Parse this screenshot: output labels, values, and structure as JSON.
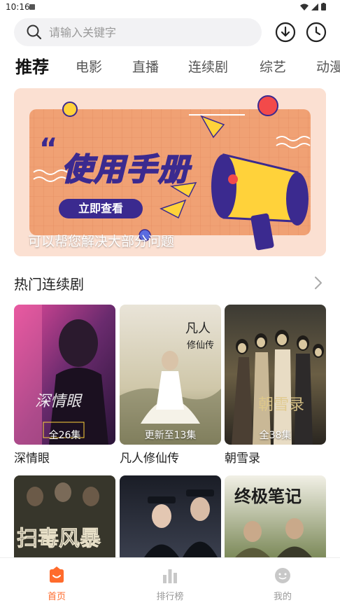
{
  "status_bar": {
    "time": "10:16"
  },
  "search": {
    "placeholder": "请输入关键字"
  },
  "tabs": [
    {
      "label": "推荐",
      "active": true
    },
    {
      "label": "电影",
      "active": false
    },
    {
      "label": "直播",
      "active": false
    },
    {
      "label": "连续剧",
      "active": false
    },
    {
      "label": "综艺",
      "active": false
    },
    {
      "label": "动漫",
      "active": false
    }
  ],
  "banner": {
    "title": "使用手册",
    "button_label": "立即查看",
    "caption": "可以帮您解决大部分问题"
  },
  "section": {
    "title": "热门连续剧"
  },
  "shows": [
    {
      "name": "深情眼",
      "badge": "全26集"
    },
    {
      "name": "凡人修仙传",
      "badge": "更新至13集"
    },
    {
      "name": "朝雪录",
      "badge": "全38集"
    },
    {
      "name": "扫毒风暴",
      "badge": ""
    },
    {
      "name": "",
      "badge": ""
    },
    {
      "name": "终极笔记",
      "badge": ""
    }
  ],
  "bottom_nav": [
    {
      "label": "首页",
      "icon": "home-icon",
      "active": true
    },
    {
      "label": "排行榜",
      "icon": "ranking-icon",
      "active": false
    },
    {
      "label": "我的",
      "icon": "profile-icon",
      "active": false
    }
  ],
  "colors": {
    "accent": "#ff6b2c",
    "banner_bg": "#fbe0d2",
    "banner_card": "#f0a174",
    "banner_ink": "#3b2a8f"
  }
}
